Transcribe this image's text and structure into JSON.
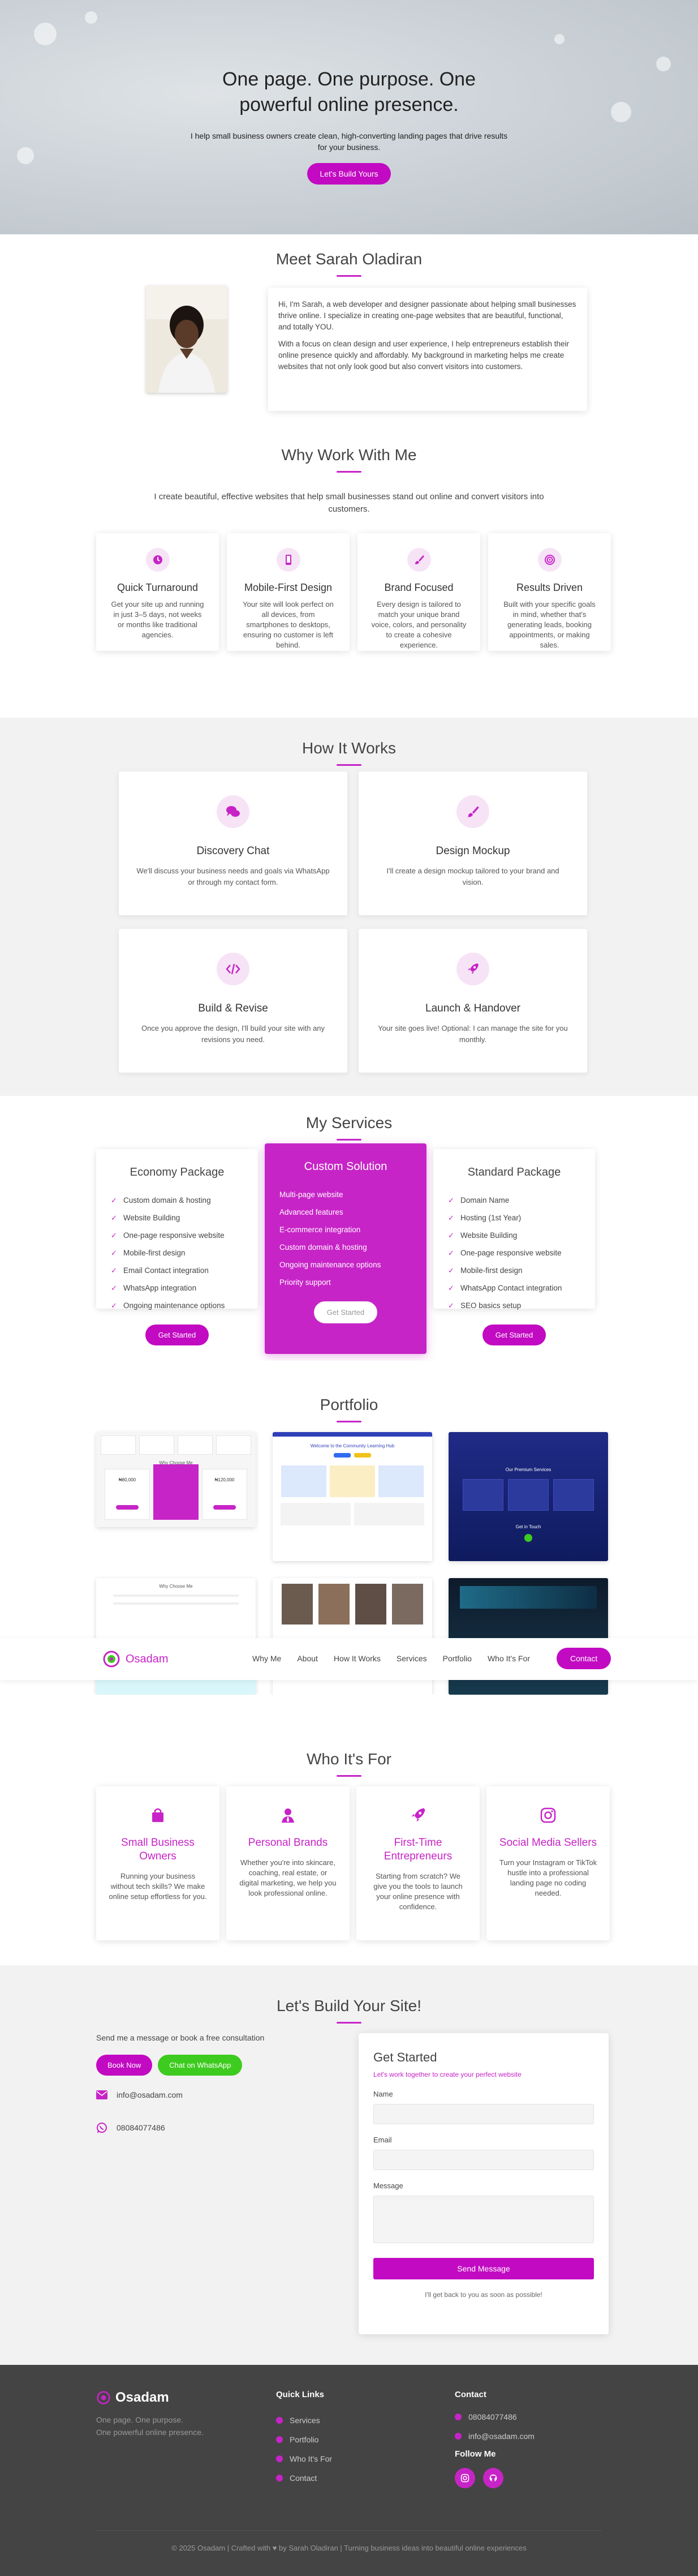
{
  "hero": {
    "title_line1": "One page. One purpose. One",
    "title_line2": "powerful online presence.",
    "subtitle_line1": "I help small business owners create clean, high-converting landing pages that drive results",
    "subtitle_line2": "for your business.",
    "cta": "Let's Build Yours"
  },
  "about": {
    "heading": "Meet Sarah Oladiran",
    "p1": "Hi, I'm Sarah, a web developer and designer passionate about helping small businesses thrive online. I specialize in creating one-page websites that are beautiful, functional, and totally YOU.",
    "p2": "With a focus on clean design and user experience, I help entrepreneurs establish their online presence quickly and affordably. My background in marketing helps me create websites that not only look good but also convert visitors into customers."
  },
  "why": {
    "heading": "Why Work With Me",
    "subtitle_line1": "I create beautiful, effective websites that help small businesses stand out online and convert visitors into",
    "subtitle_line2": "customers.",
    "cards": [
      {
        "icon": "clock-icon",
        "title": "Quick Turnaround",
        "text": "Get your site up and running in just 3–5 days, not weeks or months like traditional agencies."
      },
      {
        "icon": "mobile-icon",
        "title": "Mobile-First Design",
        "text": "Your site will look perfect on all devices, from smartphones to desktops, ensuring no customer is left behind."
      },
      {
        "icon": "paintbrush-icon",
        "title": "Brand Focused",
        "text": "Every design is tailored to match your unique brand voice, colors, and personality to create a cohesive experience."
      },
      {
        "icon": "target-icon",
        "title": "Results Driven",
        "text": "Built with your specific goals in mind, whether that's generating leads, booking appointments, or making sales."
      }
    ]
  },
  "how": {
    "heading": "How It Works",
    "steps": [
      {
        "icon": "chat-icon",
        "title": "Discovery Chat",
        "text": "We'll discuss your business needs and goals via WhatsApp or through my contact form."
      },
      {
        "icon": "paintbrush-icon",
        "title": "Design Mockup",
        "text": "I'll create a design mockup tailored to your brand and vision."
      },
      {
        "icon": "code-icon",
        "title": "Build & Revise",
        "text": "Once you approve the design, I'll build your site with any revisions you need."
      },
      {
        "icon": "rocket-icon",
        "title": "Launch & Handover",
        "text": "Your site goes live! Optional: I can manage the site for you monthly."
      }
    ]
  },
  "services": {
    "heading": "My Services",
    "packages": [
      {
        "name": "Economy Package",
        "items": [
          "Custom domain & hosting",
          "Website Building",
          "One-page responsive website",
          "Mobile-first design",
          "Email Contact integration",
          "WhatsApp integration",
          "Ongoing maintenance options"
        ],
        "cta": "Get Started"
      },
      {
        "name": "Custom Solution",
        "items": [
          "Multi-page website",
          "Advanced features",
          "E-commerce integration",
          "Custom domain & hosting",
          "Ongoing maintenance options",
          "Priority support"
        ],
        "cta": "Get Started"
      },
      {
        "name": "Standard Package",
        "items": [
          "Domain Name",
          "Hosting (1st Year)",
          "Website Building",
          "One-page responsive website",
          "Mobile-first design",
          "WhatsApp Contact integration",
          "SEO basics setup"
        ],
        "cta": "Get Started"
      }
    ]
  },
  "portfolio": {
    "heading": "Portfolio",
    "thumb1": {
      "title": "Why Choose Me",
      "price1": "₦80,000",
      "price2": "₦120,000"
    },
    "thumb2": {
      "title": "Welcome to the Community Learning Hub"
    },
    "thumb3": {
      "title": "Our Premium Services",
      "footer": "Get in Touch"
    },
    "thumb4": {
      "title": "Why Choose Me"
    }
  },
  "nav": {
    "logo": "Osadam",
    "links": [
      "Why Me",
      "About",
      "How It Works",
      "Services",
      "Portfolio",
      "Who It's For"
    ],
    "cta": "Contact"
  },
  "who": {
    "heading": "Who It's For",
    "cards": [
      {
        "icon": "shopping-bag-icon",
        "title": "Small Business Owners",
        "text": "Running your business without tech skills? We make online setup effortless for you."
      },
      {
        "icon": "user-tie-icon",
        "title": "Personal Brands",
        "text": "Whether you're into skincare, coaching, real estate, or digital marketing, we help you look professional online."
      },
      {
        "icon": "rocket-icon",
        "title": "First-Time Entrepreneurs",
        "text": "Starting from scratch? We give you the tools to launch your online presence with confidence."
      },
      {
        "icon": "instagram-icon",
        "title": "Social Media Sellers",
        "text": "Turn your Instagram or TikTok hustle into a professional landing page no coding needed."
      }
    ]
  },
  "contact": {
    "heading": "Let's Build Your Site!",
    "lead": "Send me a message or book a free consultation",
    "book_label": "Book Now",
    "whatsapp_label": "Chat on WhatsApp",
    "email": "info@osadam.com",
    "phone": "08084077486",
    "form": {
      "title": "Get Started",
      "subtitle": "Let's work together to create your perfect website",
      "name_label": "Name",
      "email_label": "Email",
      "message_label": "Message",
      "submit": "Send Message",
      "note": "I'll get back to you as soon as possible!"
    }
  },
  "footer": {
    "logo": "Osadam",
    "tag_line1": "One page. One purpose.",
    "tag_line2": "One powerful online presence.",
    "quick_links_title": "Quick Links",
    "quick_links": [
      "Services",
      "Portfolio",
      "Who It's For",
      "Contact"
    ],
    "contact_title": "Contact",
    "phone": "08084077486",
    "email": "info@osadam.com",
    "follow_title": "Follow Me",
    "copyright": "© 2025 Osadam | Crafted with ♥ by Sarah Oladiran | Turning business ideas into beautiful online experiences"
  },
  "colors": {
    "accent": "#c724c7",
    "button": "#c20ac2",
    "whatsapp": "#3ecb20",
    "footer_bg": "#444444"
  }
}
